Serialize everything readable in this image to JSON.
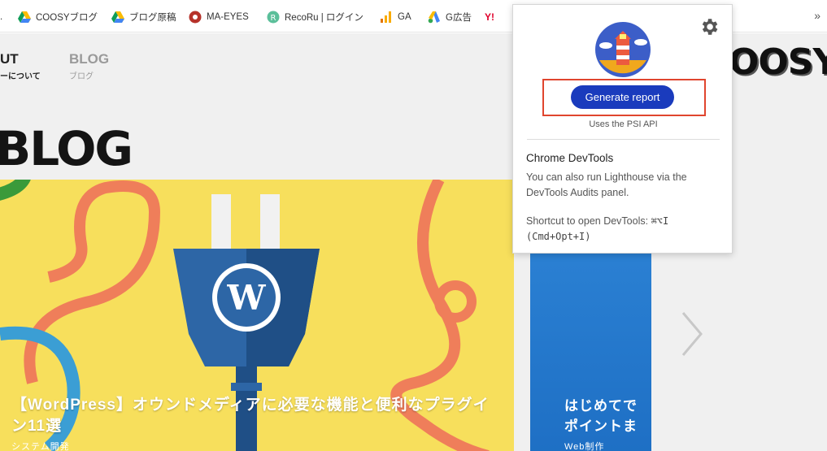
{
  "bookmarks": {
    "items": [
      {
        "label": ".",
        "icon": "dot"
      },
      {
        "label": "COOSYブログ",
        "icon": "google-drive-icon"
      },
      {
        "label": "ブログ原稿",
        "icon": "google-drive-icon"
      },
      {
        "label": "MA-EYES",
        "icon": "ma-eyes-icon"
      },
      {
        "label": "RecoRu | ログイン",
        "icon": "recoru-icon"
      },
      {
        "label": "GA",
        "icon": "analytics-icon"
      },
      {
        "label": "G広告",
        "icon": "google-ads-icon"
      },
      {
        "label": "Y!",
        "icon": "yahoo-icon"
      }
    ],
    "more": "»"
  },
  "site": {
    "nav_about": "UT",
    "nav_about_sub": "ーについて",
    "nav_blog": "BLOG",
    "nav_blog_sub": "ブログ",
    "logo": "OOSY",
    "title": "BLOG"
  },
  "cards": [
    {
      "title": "【WordPress】オウンドメディアに必要な機能と便利なプラグイン11選",
      "category": "システム開発"
    },
    {
      "title": "はじめてで\nポイントま",
      "category": "Web制作"
    }
  ],
  "popup": {
    "button": "Generate report",
    "uses": "Uses the PSI API",
    "devtools_title": "Chrome DevTools",
    "devtools_desc": "You can also run Lighthouse via the DevTools Audits panel.",
    "shortcut_label": "Shortcut to open DevTools:",
    "shortcut_mac": "⌘⌥I",
    "shortcut_keys": "(Cmd+Opt+I)"
  },
  "colors": {
    "accent_button": "#1a3bbd",
    "highlight_box": "#e0452e",
    "card1_bg": "#f7df5c",
    "card2_bg": "#2f86d8"
  }
}
